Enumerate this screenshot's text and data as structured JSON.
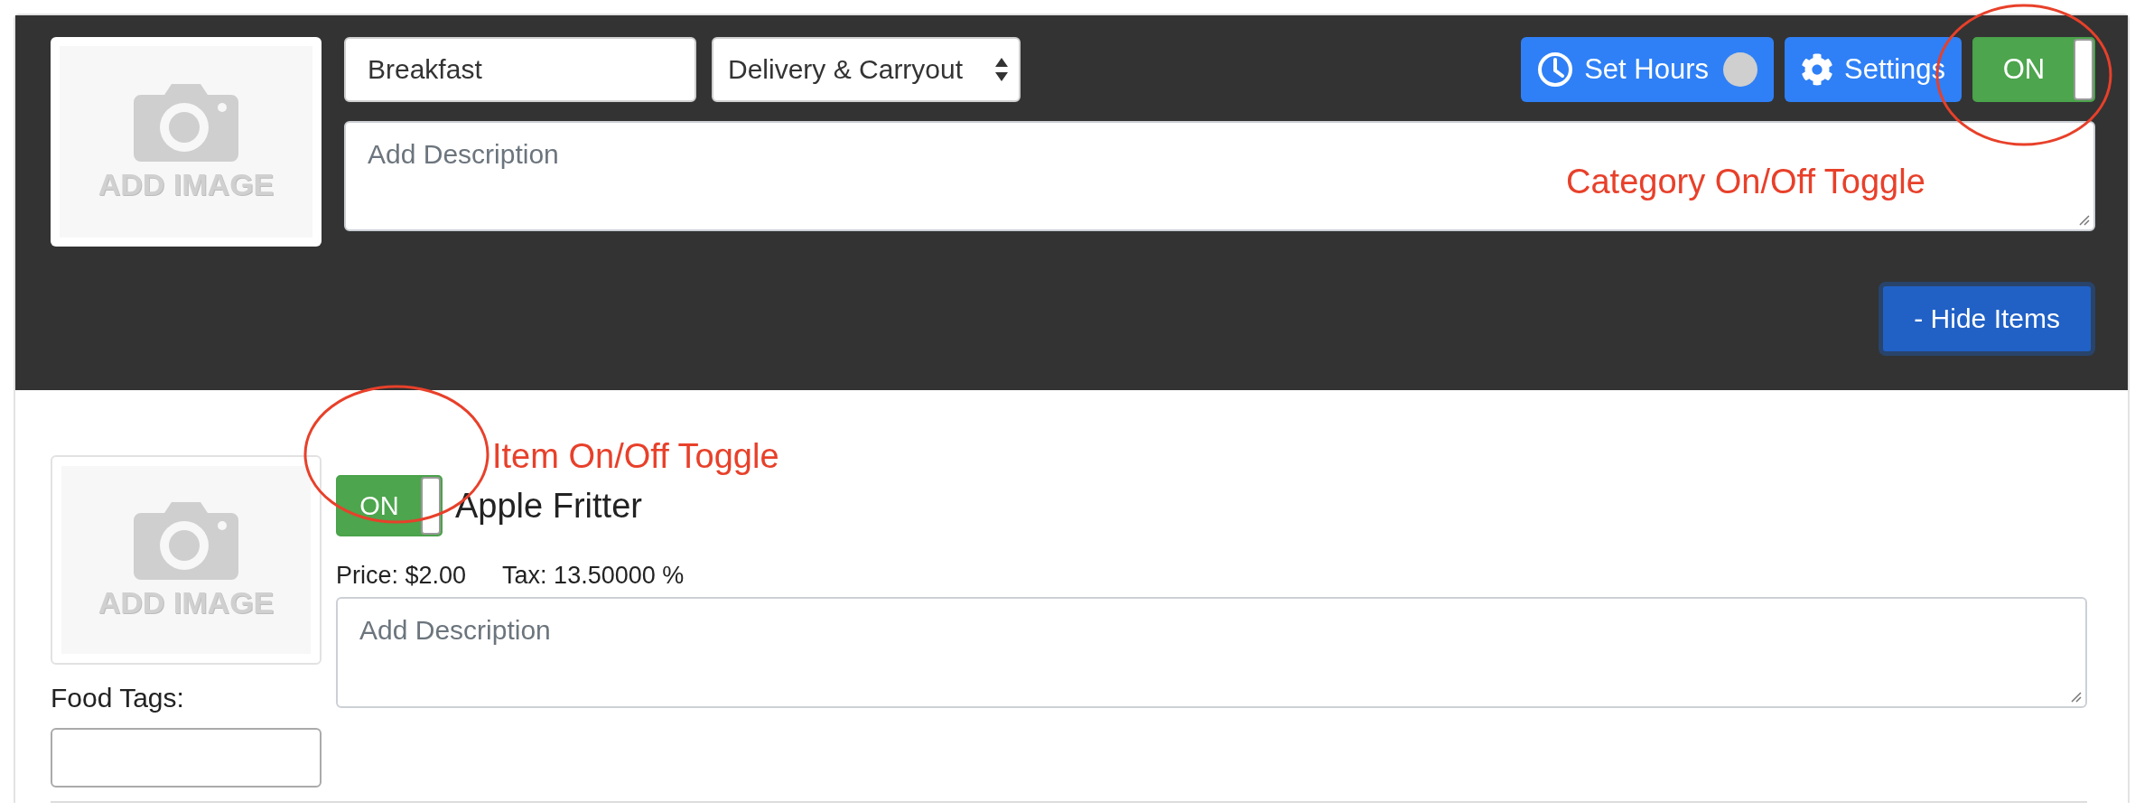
{
  "category": {
    "image_placeholder": "ADD IMAGE",
    "name": "Breakfast",
    "order_type": "Delivery & Carryout",
    "description_placeholder": "Add Description",
    "set_hours_button": "Set Hours",
    "settings_button": "Settings",
    "toggle": {
      "label": "ON",
      "on": true
    },
    "hide_items_button": "- Hide Items",
    "annotation": "Category On/Off Toggle"
  },
  "items": [
    {
      "image_placeholder": "ADD IMAGE",
      "toggle": {
        "label": "ON",
        "on": true
      },
      "name": "Apple Fritter",
      "price": "Price: $2.00",
      "tax": "Tax: 13.50000 %",
      "description_placeholder": "Add Description",
      "food_tags_label": "Food Tags:",
      "annotation": "Item On/Off Toggle"
    }
  ]
}
